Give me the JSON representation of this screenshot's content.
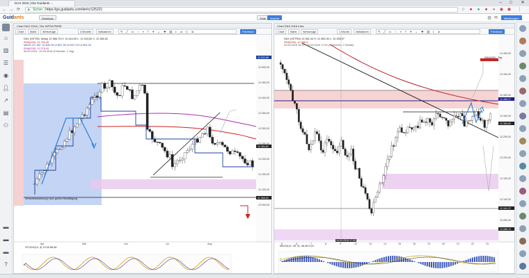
{
  "browser": {
    "tab_title": "DAX 2016 | Die Guidants ...",
    "url_secure": "Sicher",
    "url": "https://go.guidants.com/de#c/125221",
    "settings_label": "Einstellungen"
  },
  "app": {
    "logo_main": "Guid",
    "logo_accent": "ants",
    "desk_button": "Desktops",
    "view_btn_1": "Seite",
    "view_btn_2": "Ansicht",
    "login_button": "Mitteilungen"
  },
  "left_chart": {
    "title": "Chart DAX 2016 | Tick INTRA PMSE",
    "toolbar": [
      "Chart",
      "Markt",
      "Werkzeuge",
      "4 Monate",
      "Indikatoren"
    ],
    "feedback": "Feedback",
    "legend": [
      "DAX (XETRA, delay) 12.386,75  H: 12.444,05  L: 12.344,60  C: 12.384,62",
      "SMA(200): 12.759,46",
      "MACD 20,  M2: 12.908,78  12.867,09  12.637,23  12.503,26",
      "EMA(200): 12.378,44"
    ],
    "date_range": "05.05.2016 - 20.09.2016 (5 Monate, 1 Tag)",
    "annotation": "Verlaufsfortsetzung nach großer Bestätigung",
    "indicator_label": "STOCH(14, 3)  70,05   68,08",
    "price_axis": [
      "12.500,00",
      "12.450,00",
      "12.400,00",
      "12.350,00",
      "12.300,00",
      "12.250,00",
      "12.200,00",
      "12.150,00",
      "12.100,00",
      "12.050,00"
    ],
    "price_tags": {
      "upper": "12.522,86",
      "mid": "12.384,62",
      "low": "11.965,00"
    },
    "x_labels": [
      "Apr",
      "Mai",
      "Jun",
      "Jul",
      "Aug"
    ]
  },
  "right_chart": {
    "title": "Chart DAX 2016 Intra",
    "toolbar": [
      "Chart",
      "Markt",
      "Werkzeuge",
      "1 Woche",
      "Indikatoren"
    ],
    "feedback": "Feedback",
    "legend": [
      "DAX (XETRA) 12.381,44  H: 12.389,45  L: 12.355,07",
      "SMA(200): 12.386,4...",
      "04.09.2016 14:00 - 24.09.2016 17:00 (2 Wochen, 1 Stunde)"
    ],
    "box_label": "SMA(200) - Tag",
    "macd_label": "MACD(12, 26, 9)  -46,36   5,24",
    "price_axis": [
      "12.450,00",
      "12.400,00",
      "12.350,00",
      "12.300,00",
      "12.250,00",
      "12.200,00",
      "12.150,00",
      "12.100,00",
      "12.050,00"
    ],
    "price_tags": {
      "upper": "12.465,27",
      "mid": "12.384,62",
      "low": "12.161,37",
      "bottom": "12.085,73"
    },
    "crosshair_label": "14.09.2016 17:00",
    "x_labels": [
      "5",
      "6",
      "7",
      "8",
      "9",
      "12",
      "13",
      "14",
      "15",
      "16",
      "19",
      "20",
      "21",
      "22",
      "23"
    ]
  },
  "colors": {
    "accent_blue": "#3d7ddb",
    "resistance_red": "#cc2222",
    "zone_pink": "#f4c6c6",
    "zone_purple": "#e8c8ee",
    "zone_blue": "#b9cdf3",
    "trend_blue": "#2f7fd6"
  }
}
